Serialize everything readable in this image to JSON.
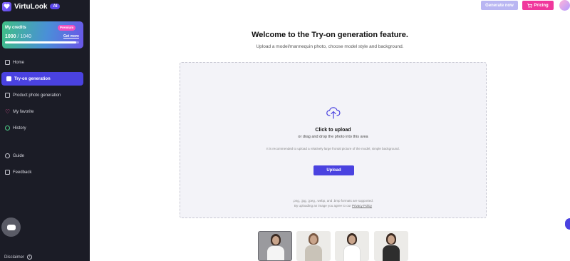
{
  "brand": {
    "name": "VirtuLook",
    "badge": "AI"
  },
  "credits": {
    "title": "My credits",
    "badge": "Premium",
    "current": "1000",
    "total": "/ 1040",
    "get_more": "Get more",
    "fraction": 0.96
  },
  "nav": [
    {
      "label": "Home",
      "icon": "home-icon"
    },
    {
      "label": "Try-on generation",
      "icon": "shirt-icon",
      "active": true
    },
    {
      "label": "Product photo generation",
      "icon": "image-icon"
    },
    {
      "label": "My favorite",
      "icon": "heart-icon"
    },
    {
      "label": "History",
      "icon": "clock-icon"
    },
    {
      "label": "Guide",
      "icon": "help-icon"
    },
    {
      "label": "Feedback",
      "icon": "feedback-icon"
    }
  ],
  "footer": {
    "disclaimer": "Disclaimer"
  },
  "header": {
    "generate_label": "Generate now",
    "pricing_label": "Pricing"
  },
  "main": {
    "title": "Welcome to the Try-on generation feature.",
    "subtitle": "Upload a model/mannequin photo, choose model style and background.",
    "upload": {
      "click": "Click to upload",
      "drag": "or drag and drop the photo into this area",
      "recommend": "It is recommended to upload a relatively large frontal picture of the model, simple background.",
      "button": "Upload",
      "formats": ".png, .jpg, .jpeg, .webp, and .bmp formats are supported.",
      "agree_prefix": "By uploading an image you agree to our",
      "privacy": "Privacy Policy"
    }
  },
  "colors": {
    "accent": "#4a42e0",
    "pink": "#f0379c",
    "sidebar": "#1b1c26"
  }
}
